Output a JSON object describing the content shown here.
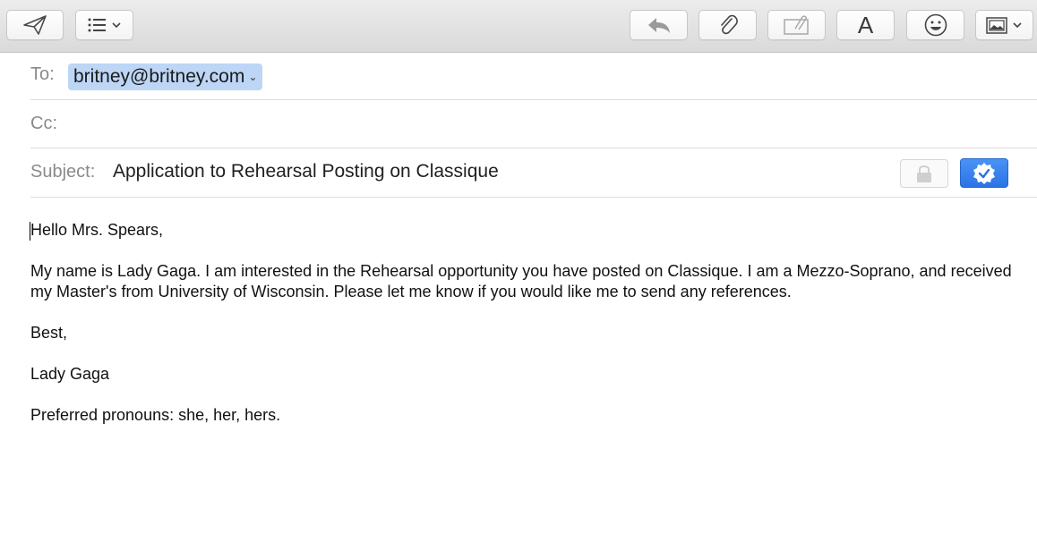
{
  "toolbar": {
    "buttons": [
      {
        "name": "send-button",
        "icon": "paper-plane-icon"
      },
      {
        "name": "list-format-button",
        "icon": "list-icon"
      },
      {
        "name": "reply-button",
        "icon": "reply-arrow-icon"
      },
      {
        "name": "attach-button",
        "icon": "paperclip-icon"
      },
      {
        "name": "markup-button",
        "icon": "markup-icon"
      },
      {
        "name": "format-button",
        "icon": "font-icon",
        "label": "A"
      },
      {
        "name": "emoji-button",
        "icon": "smiley-icon"
      },
      {
        "name": "photo-browser-button",
        "icon": "photo-icon"
      }
    ]
  },
  "header": {
    "to_label": "To:",
    "to_value": "britney@britney.com",
    "cc_label": "Cc:",
    "cc_value": "",
    "subject_label": "Subject:",
    "subject_value": "Application to Rehearsal Posting on Classique"
  },
  "message": {
    "greeting": "Hello Mrs. Spears,",
    "paragraph": "My name is Lady Gaga. I am interested in the Rehearsal opportunity you have posted on Classique. I am a Mezzo-Soprano, and received my Master's from University of Wisconsin. Please let me know if you would like me to send any references.",
    "closing": "Best,",
    "signature": "Lady Gaga",
    "pronouns": "Preferred pronouns: she, her, hers."
  },
  "colors": {
    "token_bg": "#bdd6f5",
    "accent": "#2a73e6",
    "label": "#8a8a8a"
  }
}
